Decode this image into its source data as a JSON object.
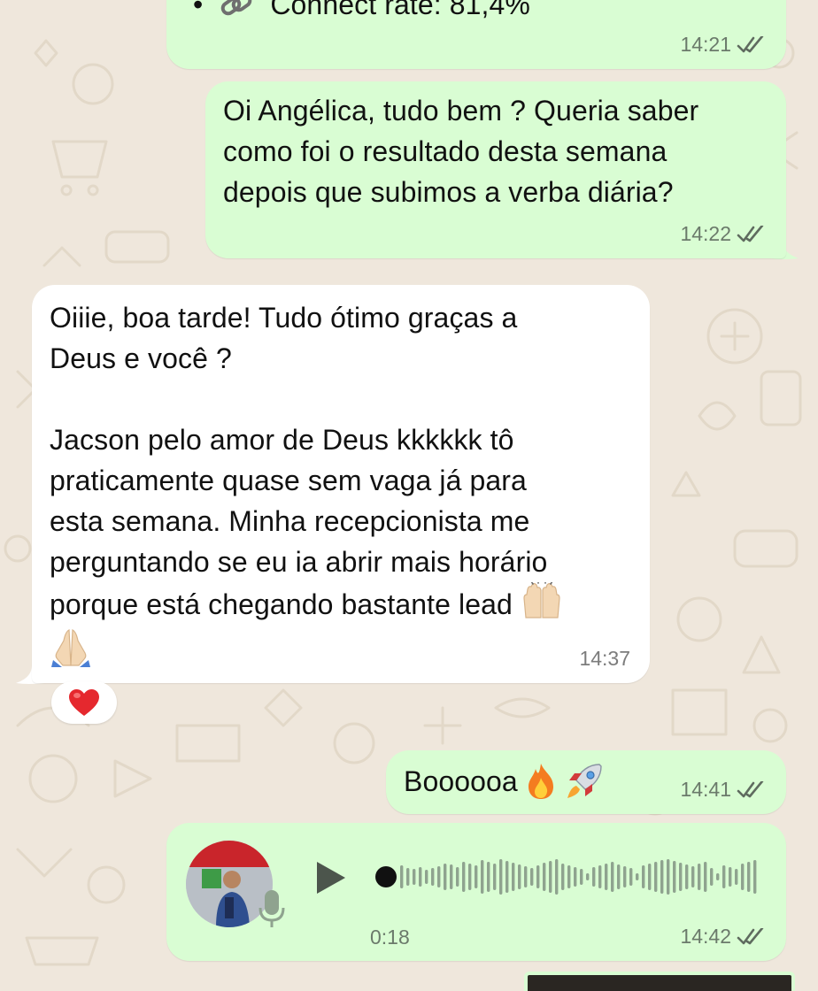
{
  "messages": {
    "m1": {
      "bullet": "•",
      "text": "Connect rate: 81,4%",
      "time": "14:21"
    },
    "m2": {
      "text": "Oi Angélica, tudo bem ? Queria saber\ncomo foi o resultado desta semana\ndepois que subimos a verba diária?",
      "time": "14:22"
    },
    "m3": {
      "text": "Oiiie, boa tarde! Tudo ótimo graças a\nDeus e você ?\n\nJacson pelo amor de Deus kkkkkk tô\npraticamente quase sem vaga já para\nesta semana. Minha recepcionista me\nperguntando se eu ia abrir mais horário\nporque está chegando bastante lead",
      "time": "14:37",
      "reaction": "heart-emoji"
    },
    "m4": {
      "text": "Boooooa",
      "time": "14:41"
    },
    "m5": {
      "type": "voice",
      "duration": "0:18",
      "time": "14:42"
    }
  },
  "colors": {
    "outgoing_bubble": "#d9fdd3",
    "incoming_bubble": "#ffffff",
    "wallpaper": "#efe7dc",
    "read_ticks": "#5f6b5f"
  }
}
